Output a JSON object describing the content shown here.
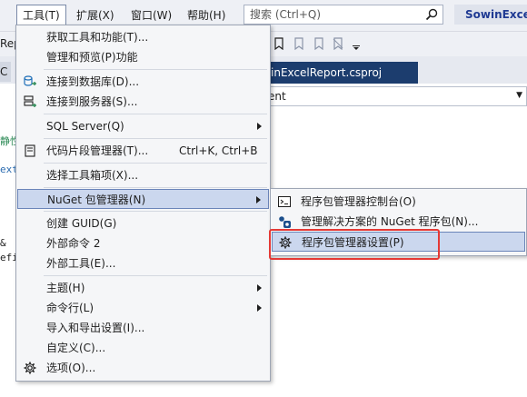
{
  "menubar": {
    "partial_left": "",
    "items": [
      {
        "label": "工具(T)"
      },
      {
        "label": "扩展(X)"
      },
      {
        "label": "窗口(W)"
      },
      {
        "label": "帮助(H)"
      }
    ],
    "search_placeholder": "搜索 (Ctrl+Q)",
    "solution_name": "SowinExcel"
  },
  "toolbar": {
    "left_text": "Rep"
  },
  "tabs": {
    "left_fragment": "C",
    "project_tab": "inExcelReport.csproj"
  },
  "navbar": {
    "text": "ent"
  },
  "editor_fragments": [
    "静性",
    "ext",
    "&",
    "efi"
  ],
  "tools_menu": {
    "items": [
      {
        "label": "获取工具和功能(T)..."
      },
      {
        "label": "管理和预览(P)功能"
      },
      {
        "label": "连接到数据库(D)..."
      },
      {
        "label": "连接到服务器(S)..."
      },
      {
        "label": "SQL Server(Q)"
      },
      {
        "label": "代码片段管理器(T)...",
        "shortcut": "Ctrl+K, Ctrl+B"
      },
      {
        "label": "选择工具箱项(X)..."
      },
      {
        "label": "NuGet 包管理器(N)"
      },
      {
        "label": "创建 GUID(G)"
      },
      {
        "label": "外部命令 2"
      },
      {
        "label": "外部工具(E)..."
      },
      {
        "label": "主题(H)"
      },
      {
        "label": "命令行(L)"
      },
      {
        "label": "导入和导出设置(I)..."
      },
      {
        "label": "自定义(C)..."
      },
      {
        "label": "选项(O)..."
      }
    ]
  },
  "nuget_submenu": {
    "items": [
      {
        "label": "程序包管理器控制台(O)"
      },
      {
        "label": "管理解决方案的 NuGet 程序包(N)..."
      },
      {
        "label": "程序包管理器设置(P)"
      }
    ]
  },
  "colors": {
    "highlight_bg": "#cbd7ee",
    "highlight_border": "#6b85b9",
    "annotation_red": "#e53935",
    "solution_name": "#1f3a93"
  }
}
